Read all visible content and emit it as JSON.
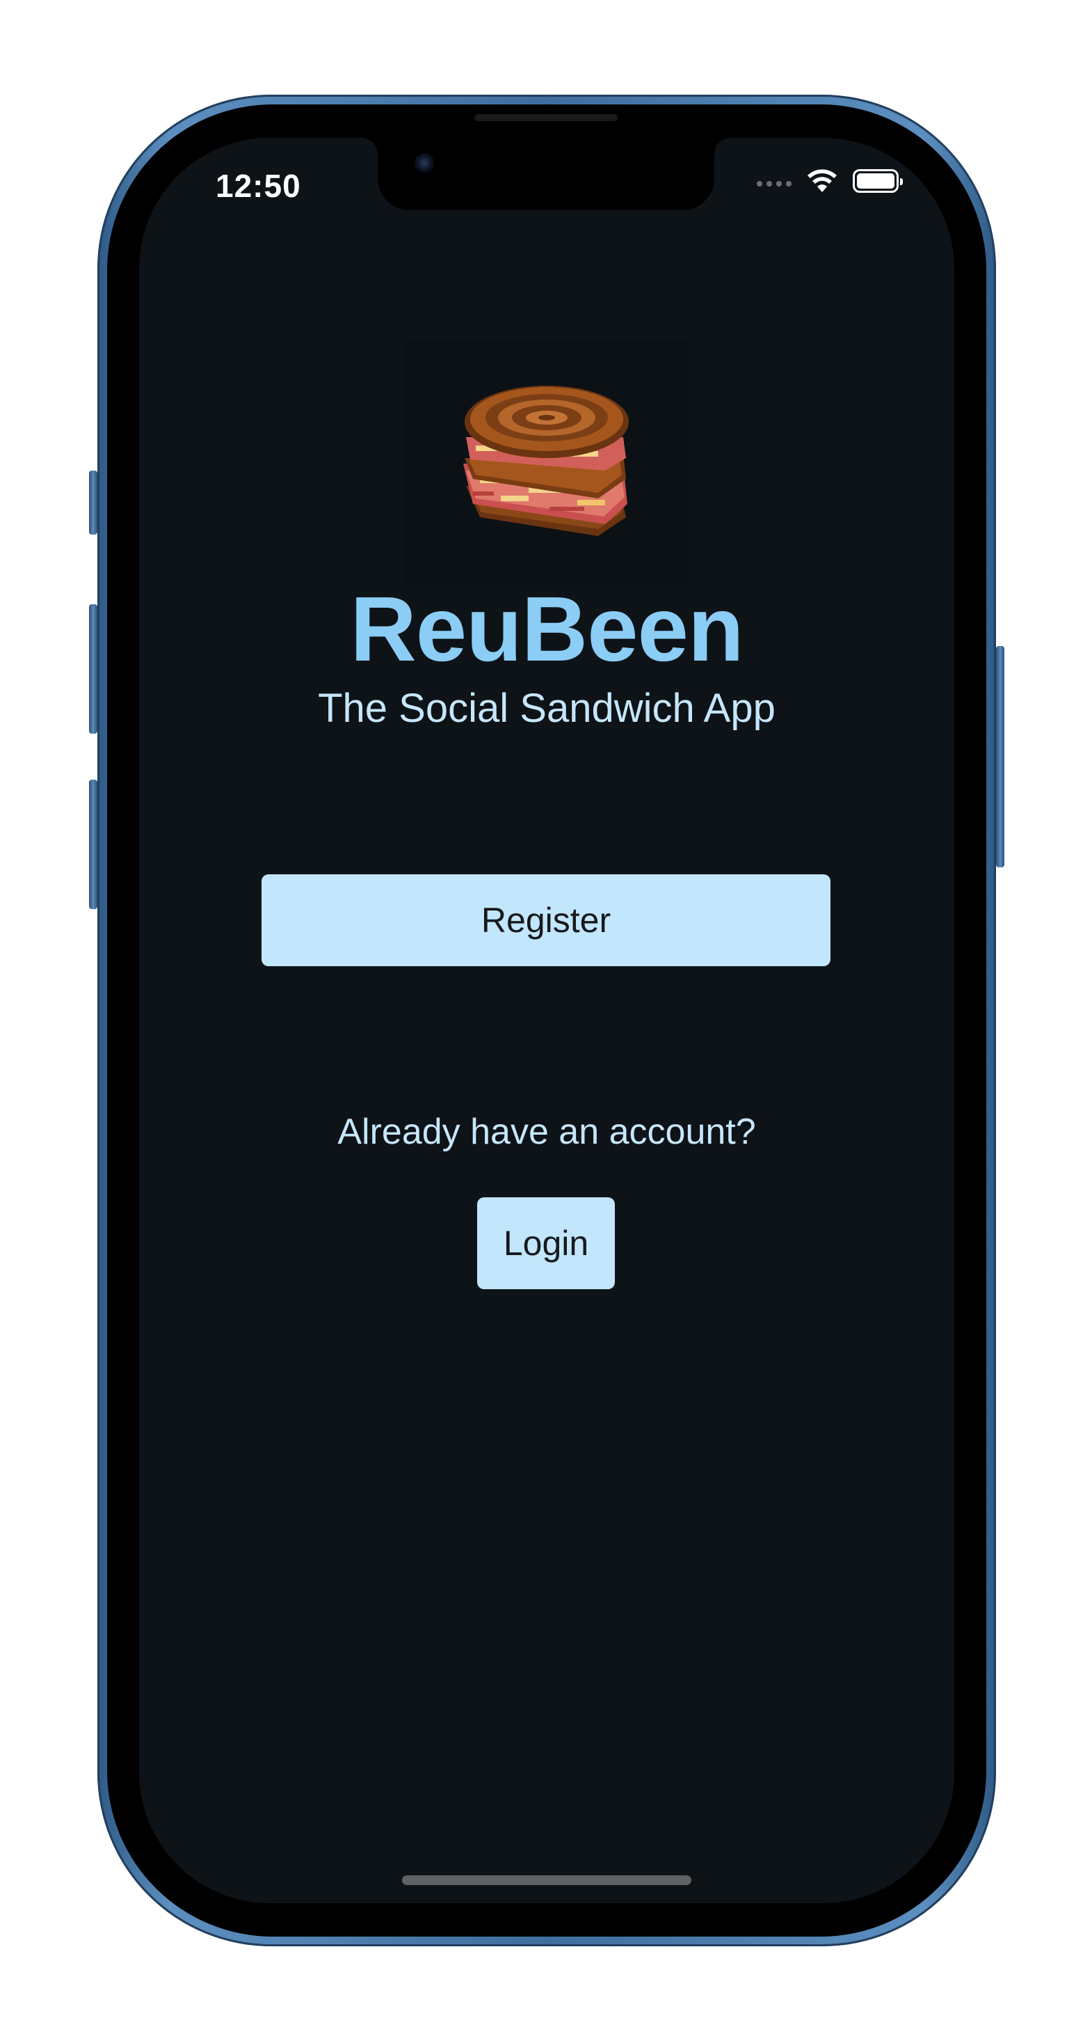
{
  "status_bar": {
    "time": "12:50",
    "wifi_icon": "wifi-icon",
    "battery_icon": "battery-full-icon"
  },
  "app": {
    "logo": "reuben-sandwich-pixel-icon",
    "title": "ReuBeen",
    "subtitle": "The Social Sandwich App"
  },
  "actions": {
    "register_label": "Register",
    "account_prompt": "Already have an account?",
    "login_label": "Login"
  },
  "colors": {
    "background": "#0e1318",
    "title": "#8bcdf5",
    "text": "#c6e6fa",
    "button": "#c2e6fb",
    "button_text": "#16191d"
  }
}
